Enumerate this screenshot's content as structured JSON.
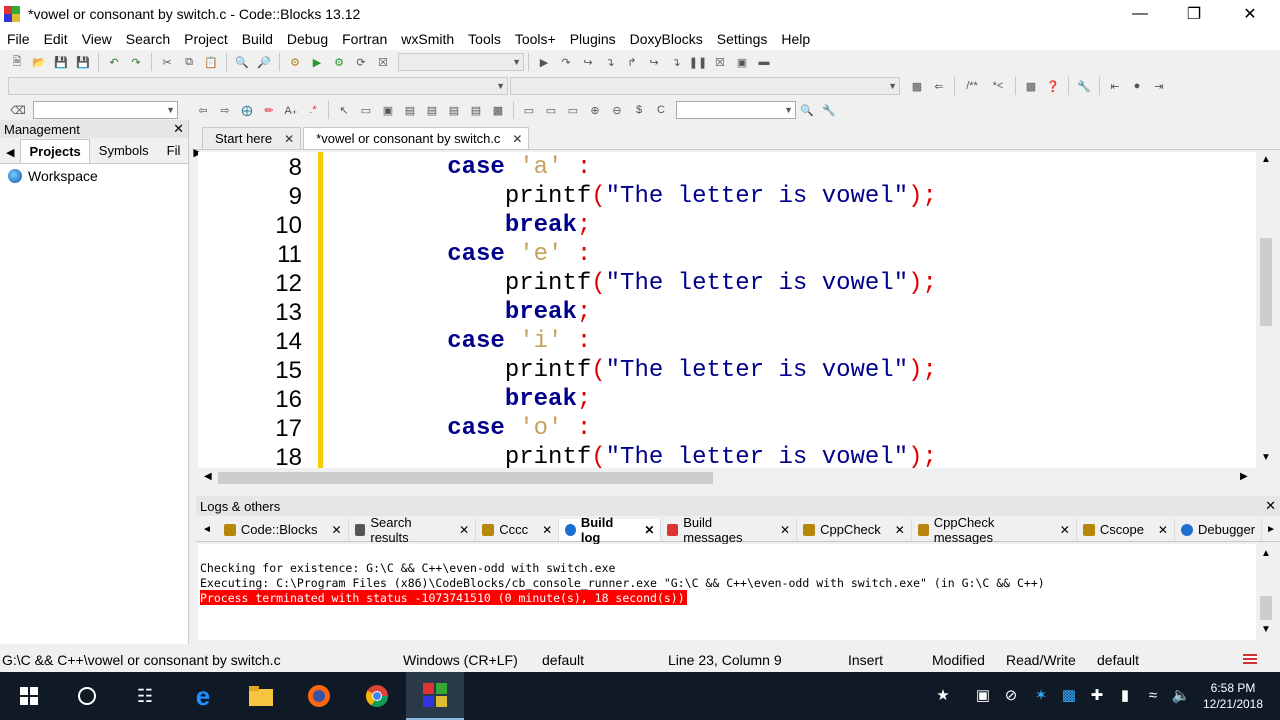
{
  "window": {
    "title": "*vowel or consonant by switch.c - Code::Blocks 13.12"
  },
  "menu": [
    "File",
    "Edit",
    "View",
    "Search",
    "Project",
    "Build",
    "Debug",
    "Fortran",
    "wxSmith",
    "Tools",
    "Tools+",
    "Plugins",
    "DoxyBlocks",
    "Settings",
    "Help"
  ],
  "management": {
    "title": "Management",
    "tabs": [
      "Projects",
      "Symbols",
      "Fil"
    ],
    "workspace": "Workspace"
  },
  "editor_tabs": [
    {
      "label": "Start here"
    },
    {
      "label": "*vowel or consonant by switch.c"
    }
  ],
  "code_lines": [
    {
      "num": "8",
      "segments": [
        {
          "t": "        ",
          "c": "fn"
        },
        {
          "t": "case",
          "c": "kw"
        },
        {
          "t": " ",
          "c": "fn"
        },
        {
          "t": "'a'",
          "c": "ch"
        },
        {
          "t": " ",
          "c": "fn"
        },
        {
          "t": ":",
          "c": "punc"
        }
      ]
    },
    {
      "num": "9",
      "segments": [
        {
          "t": "            printf",
          "c": "fn"
        },
        {
          "t": "(",
          "c": "punc"
        },
        {
          "t": "\"The letter is vowel\"",
          "c": "str"
        },
        {
          "t": ");",
          "c": "punc"
        }
      ]
    },
    {
      "num": "10",
      "segments": [
        {
          "t": "            ",
          "c": "fn"
        },
        {
          "t": "break",
          "c": "kw"
        },
        {
          "t": ";",
          "c": "punc"
        }
      ]
    },
    {
      "num": "11",
      "segments": [
        {
          "t": "        ",
          "c": "fn"
        },
        {
          "t": "case",
          "c": "kw"
        },
        {
          "t": " ",
          "c": "fn"
        },
        {
          "t": "'e'",
          "c": "ch"
        },
        {
          "t": " ",
          "c": "fn"
        },
        {
          "t": ":",
          "c": "punc"
        }
      ]
    },
    {
      "num": "12",
      "segments": [
        {
          "t": "            printf",
          "c": "fn"
        },
        {
          "t": "(",
          "c": "punc"
        },
        {
          "t": "\"The letter is vowel\"",
          "c": "str"
        },
        {
          "t": ");",
          "c": "punc"
        }
      ]
    },
    {
      "num": "13",
      "segments": [
        {
          "t": "            ",
          "c": "fn"
        },
        {
          "t": "break",
          "c": "kw"
        },
        {
          "t": ";",
          "c": "punc"
        }
      ]
    },
    {
      "num": "14",
      "segments": [
        {
          "t": "        ",
          "c": "fn"
        },
        {
          "t": "case",
          "c": "kw"
        },
        {
          "t": " ",
          "c": "fn"
        },
        {
          "t": "'i'",
          "c": "ch"
        },
        {
          "t": " ",
          "c": "fn"
        },
        {
          "t": ":",
          "c": "punc"
        }
      ]
    },
    {
      "num": "15",
      "segments": [
        {
          "t": "            printf",
          "c": "fn"
        },
        {
          "t": "(",
          "c": "punc"
        },
        {
          "t": "\"The letter is vowel\"",
          "c": "str"
        },
        {
          "t": ");",
          "c": "punc"
        }
      ]
    },
    {
      "num": "16",
      "segments": [
        {
          "t": "            ",
          "c": "fn"
        },
        {
          "t": "break",
          "c": "kw"
        },
        {
          "t": ";",
          "c": "punc"
        }
      ]
    },
    {
      "num": "17",
      "segments": [
        {
          "t": "        ",
          "c": "fn"
        },
        {
          "t": "case",
          "c": "kw"
        },
        {
          "t": " ",
          "c": "fn"
        },
        {
          "t": "'o'",
          "c": "ch"
        },
        {
          "t": " ",
          "c": "fn"
        },
        {
          "t": ":",
          "c": "punc"
        }
      ]
    },
    {
      "num": "18",
      "segments": [
        {
          "t": "            printf",
          "c": "fn"
        },
        {
          "t": "(",
          "c": "punc"
        },
        {
          "t": "\"The letter is vowel\"",
          "c": "str"
        },
        {
          "t": ");",
          "c": "punc"
        }
      ]
    }
  ],
  "logs": {
    "title": "Logs & others",
    "tabs": [
      {
        "label": "Code::Blocks",
        "icon": "pencil-icon"
      },
      {
        "label": "Search results",
        "icon": "magnifier-icon"
      },
      {
        "label": "Cccc",
        "icon": "pencil-icon"
      },
      {
        "label": "Build log",
        "icon": "gear-icon"
      },
      {
        "label": "Build messages",
        "icon": "pin-icon"
      },
      {
        "label": "CppCheck",
        "icon": "pencil-icon"
      },
      {
        "label": "CppCheck messages",
        "icon": "pencil-icon"
      },
      {
        "label": "Cscope",
        "icon": "pencil-icon"
      },
      {
        "label": "Debugger",
        "icon": "gear-icon"
      }
    ],
    "lines": [
      "Checking for existence: G:\\C && C++\\even-odd with switch.exe",
      "Executing: C:\\Program Files (x86)\\CodeBlocks/cb_console_runner.exe \"G:\\C && C++\\even-odd with switch.exe\" (in G:\\C && C++)"
    ],
    "error_line": "Process terminated with status -1073741510 (0 minute(s), 18 second(s))"
  },
  "status": {
    "path": "G:\\C && C++\\vowel or consonant by switch.c",
    "eol": "Windows (CR+LF)",
    "encoding": "default",
    "position": "Line 23, Column 9",
    "mode": "Insert",
    "modified": "Modified",
    "access": "Read/Write",
    "extra": "default"
  },
  "clock": {
    "time": "6:58 PM",
    "date": "12/21/2018"
  },
  "colors": {
    "keyword": "#00008b",
    "char_literal": "#c8a060",
    "punctuation": "#dd0000",
    "change_bar": "#f5cd00",
    "error_bg": "#ff0000",
    "taskbar": "#0f1a26"
  }
}
